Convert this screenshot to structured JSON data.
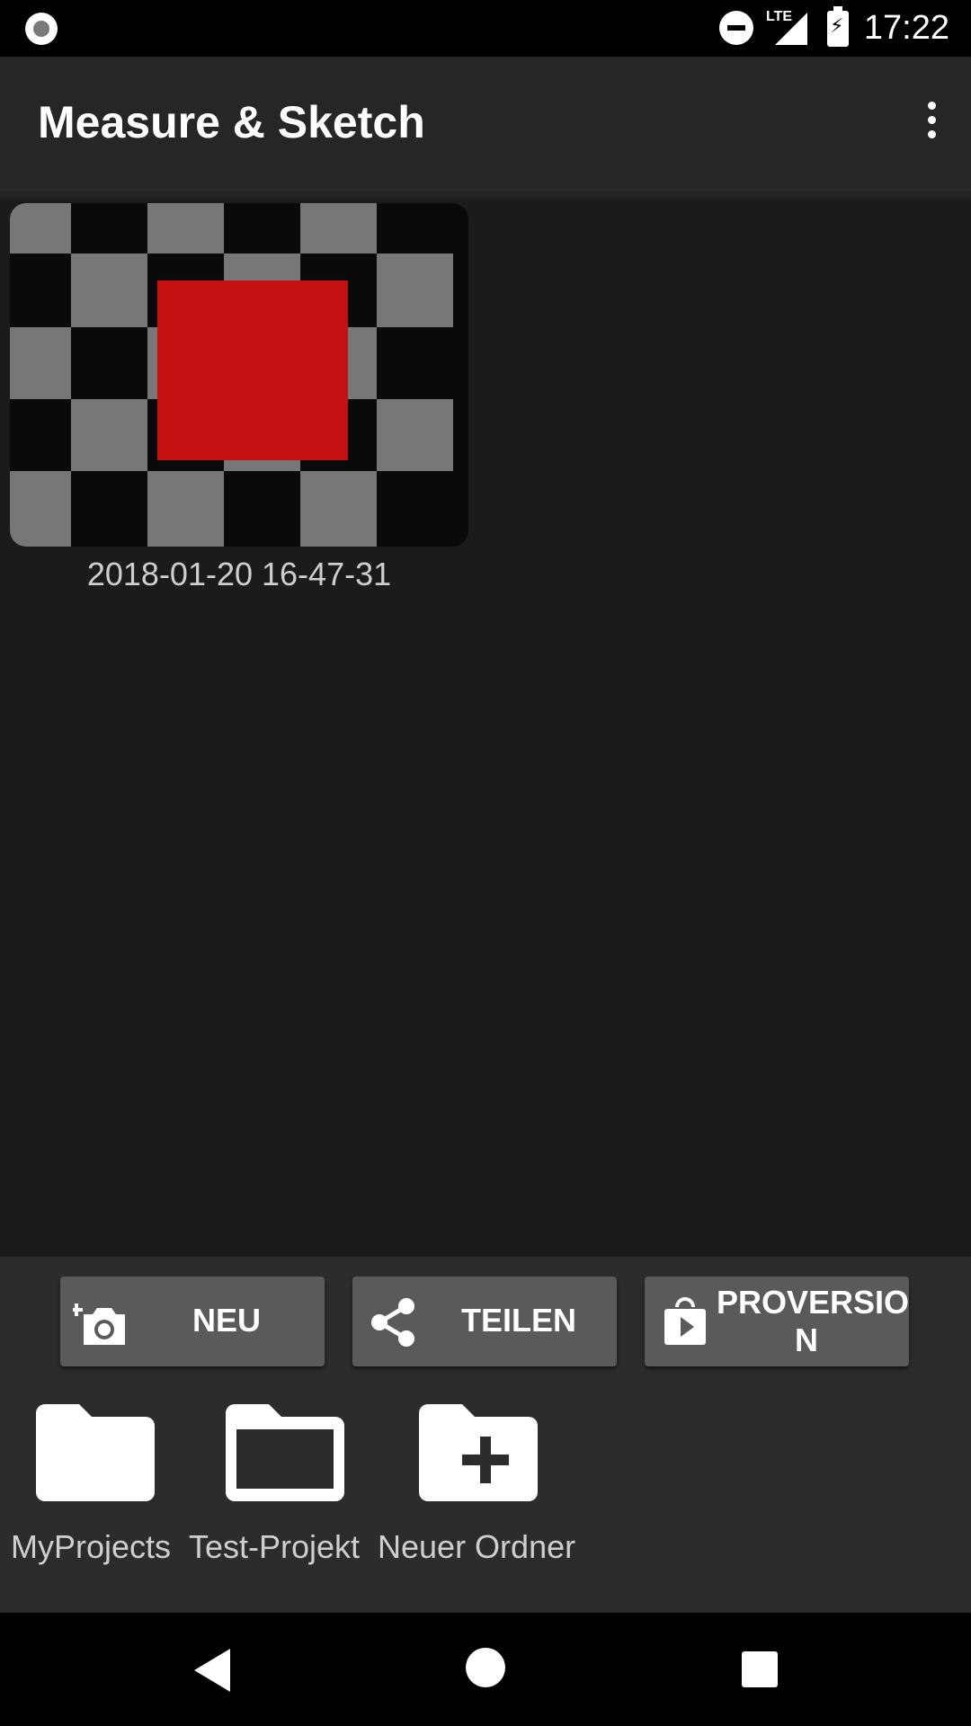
{
  "status_bar": {
    "time": "17:22",
    "network": "LTE",
    "icons": [
      "record-icon",
      "do-not-disturb-icon",
      "lte-signal-icon",
      "battery-charging-icon"
    ]
  },
  "app_bar": {
    "title": "Measure & Sketch",
    "overflow_icon": "more-vert-icon"
  },
  "projects": [
    {
      "caption": "2018-01-20 16-47-31",
      "thumbnail": "checkerboard-with-red-square"
    }
  ],
  "actions": {
    "new_label": "NEU",
    "share_label": "TEILEN",
    "pro_label_line1": "PROVERSIO",
    "pro_label_line2": "N",
    "new_icon": "add-photo-icon",
    "share_icon": "share-icon",
    "pro_icon": "play-store-icon"
  },
  "folders": [
    {
      "label": "MyProjects",
      "icon": "folder-filled-icon"
    },
    {
      "label": "Test-Projekt",
      "icon": "folder-outline-icon"
    },
    {
      "label": "Neuer Ordner",
      "icon": "create-new-folder-icon"
    }
  ],
  "nav_bar": {
    "icons": [
      "back-icon",
      "home-icon",
      "recents-icon"
    ]
  },
  "colors": {
    "background": "#1b1b1b",
    "app_bar": "#262626",
    "panel": "#2c2c2c",
    "button": "#5a5a5a",
    "accent_red": "#c41010"
  }
}
